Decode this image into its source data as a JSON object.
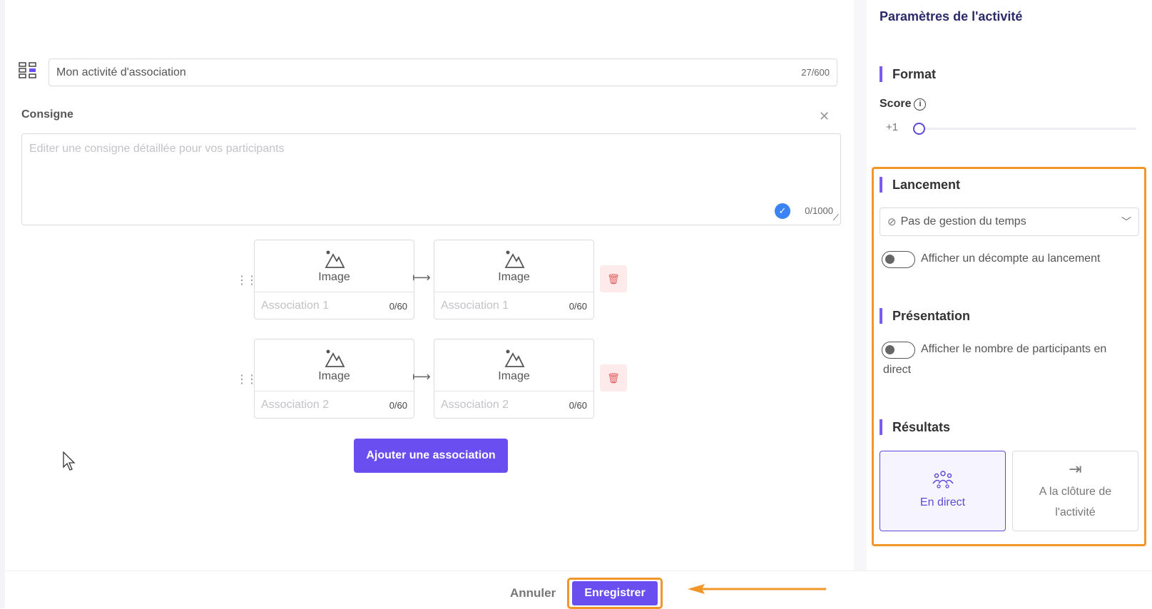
{
  "activity": {
    "title_value": "Mon activité d'association",
    "title_count": "27/600"
  },
  "consigne": {
    "label": "Consigne",
    "placeholder": "Editer une consigne détaillée pour vos participants",
    "count": "0/1000"
  },
  "associations": [
    {
      "left": {
        "image_label": "Image",
        "placeholder": "Association 1",
        "count": "0/60"
      },
      "right": {
        "image_label": "Image",
        "placeholder": "Association 1",
        "count": "0/60"
      }
    },
    {
      "left": {
        "image_label": "Image",
        "placeholder": "Association 2",
        "count": "0/60"
      },
      "right": {
        "image_label": "Image",
        "placeholder": "Association 2",
        "count": "0/60"
      }
    }
  ],
  "add_button": "Ajouter une association",
  "sidebar": {
    "title": "Paramètres de l'activité",
    "format": {
      "heading": "Format",
      "score_label": "Score",
      "score_value": "+1"
    },
    "lancement": {
      "heading": "Lancement",
      "select_value": "Pas de gestion du temps",
      "countdown_toggle_label": "Afficher un décompte au lancement",
      "countdown_enabled": false
    },
    "presentation": {
      "heading": "Présentation",
      "participants_toggle_label_1": "Afficher le nombre de participants en",
      "participants_toggle_label_2": "direct",
      "participants_enabled": false
    },
    "resultats": {
      "heading": "Résultats",
      "options": [
        {
          "label": "En direct",
          "icon": "group-icon",
          "selected": true
        },
        {
          "label_1": "A la clôture de",
          "label_2": "l'activité",
          "icon": "arrow-to-end-icon",
          "selected": false
        }
      ]
    }
  },
  "footer": {
    "cancel": "Annuler",
    "save": "Enregistrer"
  },
  "colors": {
    "primary": "#6b4ef0",
    "highlight": "#f2962a",
    "accent_bar": "#7a5cf5"
  }
}
